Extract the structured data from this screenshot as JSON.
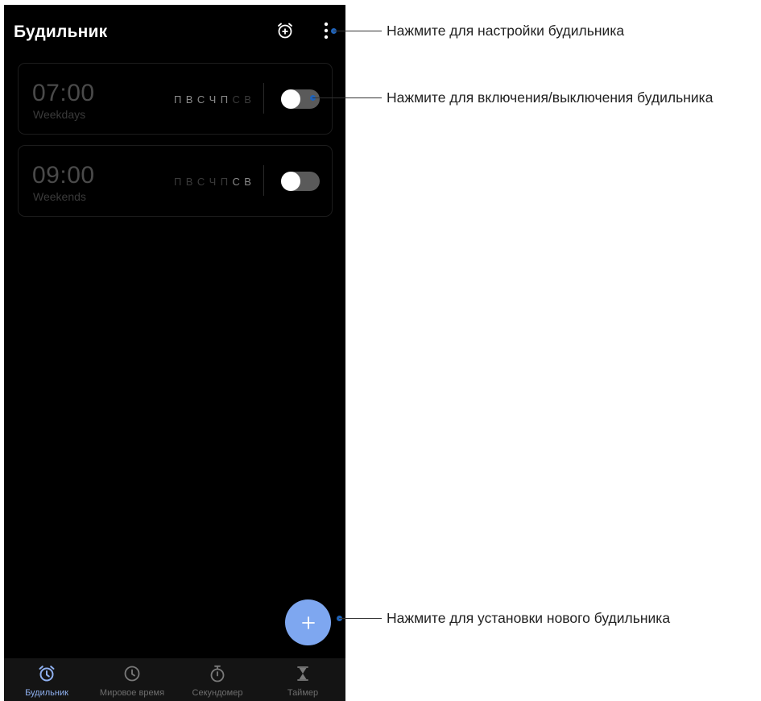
{
  "header": {
    "title": "Будильник",
    "add_alarm_icon": "alarm-add-icon",
    "menu_icon": "more-vertical-icon"
  },
  "alarms": [
    {
      "time": "07:00",
      "label": "Weekdays",
      "days": [
        {
          "letter": "П",
          "active": true
        },
        {
          "letter": "В",
          "active": true
        },
        {
          "letter": "С",
          "active": true
        },
        {
          "letter": "Ч",
          "active": true
        },
        {
          "letter": "П",
          "active": true
        },
        {
          "letter": "С",
          "active": false
        },
        {
          "letter": "В",
          "active": false
        }
      ],
      "enabled": false
    },
    {
      "time": "09:00",
      "label": "Weekends",
      "days": [
        {
          "letter": "П",
          "active": false
        },
        {
          "letter": "В",
          "active": false
        },
        {
          "letter": "С",
          "active": false
        },
        {
          "letter": "Ч",
          "active": false
        },
        {
          "letter": "П",
          "active": false
        },
        {
          "letter": "С",
          "active": true
        },
        {
          "letter": "В",
          "active": true
        }
      ],
      "enabled": false
    }
  ],
  "fab": {
    "icon": "plus-icon"
  },
  "nav": {
    "tabs": [
      {
        "label": "Будильник",
        "icon": "alarm-clock-icon",
        "active": true
      },
      {
        "label": "Мировое время",
        "icon": "clock-icon",
        "active": false
      },
      {
        "label": "Секундомер",
        "icon": "stopwatch-icon",
        "active": false
      },
      {
        "label": "Таймер",
        "icon": "hourglass-icon",
        "active": false
      }
    ]
  },
  "callouts": {
    "settings": "Нажмите для настройки будильника",
    "toggle": "Нажмите для включения/выключения будильника",
    "new_alarm": "Нажмите для установки нового будильника"
  },
  "colors": {
    "accent": "#8fb0ef",
    "fab": "#7ea7f0",
    "callout_dot": "#1f62b8",
    "background": "#000000"
  }
}
